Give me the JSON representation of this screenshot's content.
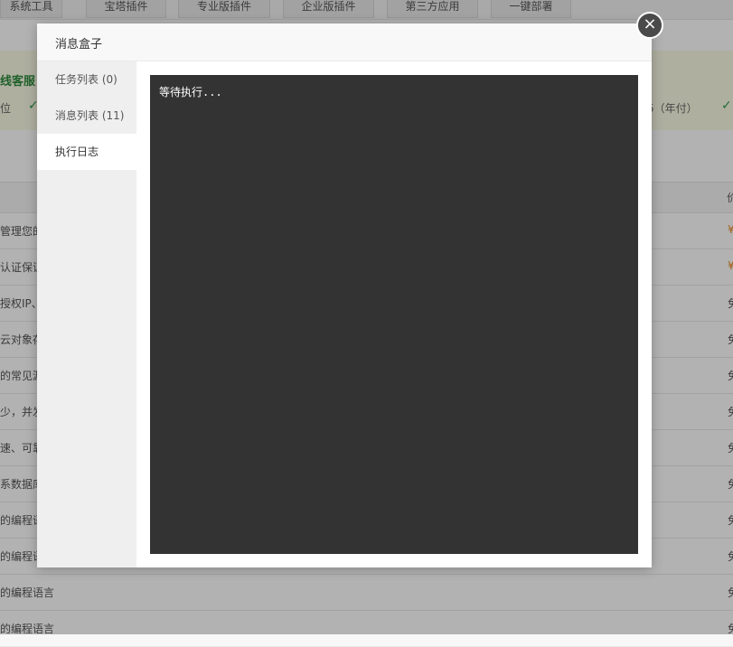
{
  "background": {
    "nav_tabs": [
      "系统工具",
      "宝塔插件",
      "专业版插件",
      "企业版插件",
      "第三方应用",
      "一键部署"
    ],
    "banner": {
      "service_text": "线客服",
      "position_text": "位",
      "yearly_text": "5（年付）"
    },
    "table": {
      "header_partial": "价",
      "rows": [
        {
          "text": "管理您的",
          "price": "¥"
        },
        {
          "text": "认证保证",
          "price": "¥"
        },
        {
          "text": "授权IP、",
          "price": "免"
        },
        {
          "text": "云对象存",
          "price": "免"
        },
        {
          "text": "的常见漏",
          "price": "免"
        },
        {
          "text": "少，并发",
          "price": "免"
        },
        {
          "text": "速、可靠",
          "price": "免"
        },
        {
          "text": "系数据库",
          "price": "免"
        },
        {
          "text": "的编程语",
          "price": "免"
        },
        {
          "text": "的编程语",
          "price": "免"
        },
        {
          "text": "的编程语言",
          "price": "免"
        },
        {
          "text": "的编程语言",
          "price": "免"
        }
      ]
    }
  },
  "modal": {
    "title": "消息盒子",
    "close_symbol": "×",
    "tabs": [
      {
        "label": "任务列表 (0)",
        "active": false
      },
      {
        "label": "消息列表 (11)",
        "active": false
      },
      {
        "label": "执行日志",
        "active": true
      }
    ],
    "log_text": "等待执行..."
  },
  "colors": {
    "console_bg": "#333333",
    "accent_green": "#2e8b3e",
    "price_orange": "#e8891e"
  }
}
